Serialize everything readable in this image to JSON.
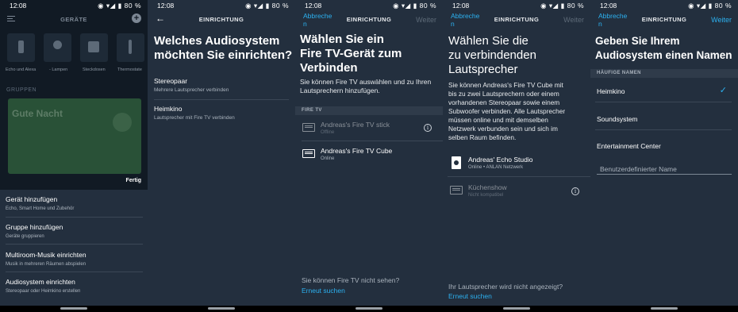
{
  "status": {
    "time": "12:08",
    "battery": "80 %"
  },
  "screen1": {
    "header_title": "GERÄTE",
    "tiles": [
      "Echo und Alexa",
      "- Lampen",
      "Steckdosen",
      "Thermostate"
    ],
    "section": "GRUPPEN",
    "card_title": "Gute Nacht",
    "done": "Fertig",
    "menu": [
      {
        "title": "Gerät hinzufügen",
        "sub": "Echo, Smart Home und Zubehör"
      },
      {
        "title": "Gruppe hinzufügen",
        "sub": "Geräte gruppieren"
      },
      {
        "title": "Multiroom-Musik einrichten",
        "sub": "Musik in mehreren Räumen abspielen"
      },
      {
        "title": "Audiosystem einrichten",
        "sub": "Stereopaar oder Heimkino erstellen"
      }
    ]
  },
  "screen2": {
    "header_title": "EINRICHTUNG",
    "heading_line1": "Welches Audiosystem",
    "heading_line2": "möchten Sie einrichten?",
    "options": [
      {
        "title": "Stereopaar",
        "sub": "Mehrere Lautsprecher verbinden"
      },
      {
        "title": "Heimkino",
        "sub": "Lautsprecher mit Fire TV verbinden"
      }
    ]
  },
  "screen3": {
    "cancel_line1": "Abbreche",
    "cancel_line2": "n",
    "header_title": "EINRICHTUNG",
    "next": "Weiter",
    "heading_line1": "Wählen Sie ein",
    "heading_line2": "Fire TV-Gerät zum",
    "heading_line3": "Verbinden",
    "para_line1": "Sie können Fire TV auswählen und zu Ihren",
    "para_line2": "Lautsprechern hinzufügen.",
    "section": "FIRE TV",
    "devices": [
      {
        "name": "Andreas's Fire TV stick",
        "status": "Offline"
      },
      {
        "name": "Andreas's Fire TV Cube",
        "status": "Online"
      }
    ],
    "footer_question": "Sie können Fire TV nicht sehen?",
    "footer_action": "Erneut suchen"
  },
  "screen4": {
    "cancel_line1": "Abbreche",
    "cancel_line2": "n",
    "header_title": "EINRICHTUNG",
    "next": "Weiter",
    "heading_line1": "Wählen Sie die",
    "heading_line2": "zu verbindenden",
    "heading_line3": "Lautsprecher",
    "para_lines": [
      "Sie können Andreas's Fire TV Cube mit",
      "bis zu zwei Lautsprechern oder einem",
      "vorhandenen Stereopaar sowie einem",
      "Subwoofer verbinden. Alle Lautsprecher",
      "müssen online und mit demselben",
      "Netzwerk verbunden sein und sich im",
      "selben Raum befinden."
    ],
    "devices": [
      {
        "name": "Andreas' Echo Studio",
        "status": "Online • ANLAN Netzwerk"
      },
      {
        "name": "Küchenshow",
        "status": "Nicht kompatibel"
      }
    ],
    "footer_question": "Ihr Lautsprecher wird nicht angezeigt?",
    "footer_action": "Erneut suchen"
  },
  "screen5": {
    "cancel_line1": "Abbreche",
    "cancel_line2": "n",
    "header_title": "EINRICHTUNG",
    "next": "Weiter",
    "heading_line1": "Geben Sie Ihrem",
    "heading_line2": "Audiosystem einen Namen",
    "section": "HÄUFIGE NAMEN",
    "names": [
      "Heimkino",
      "Soundsystem",
      "Entertainment Center"
    ],
    "custom_placeholder": "Benutzerdefinierter Name"
  }
}
